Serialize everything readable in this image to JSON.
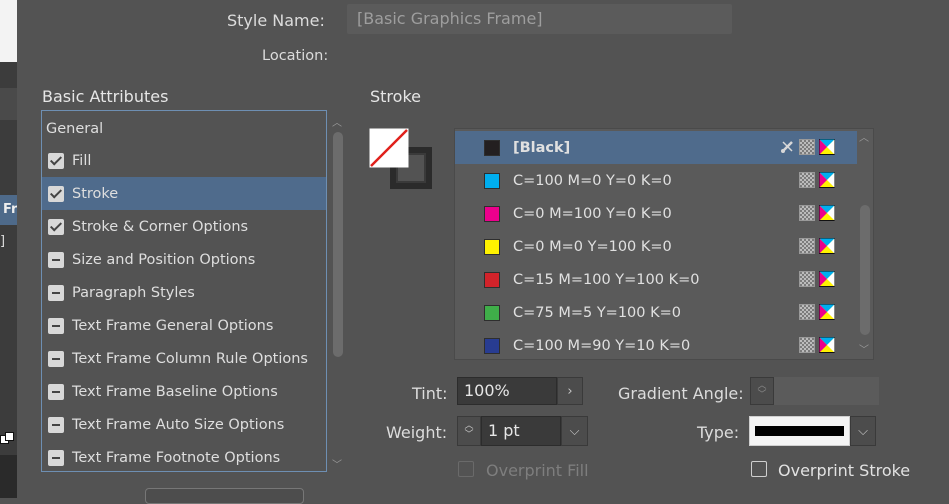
{
  "style_name": {
    "label": "Style Name:",
    "value": "[Basic Graphics Frame]"
  },
  "location": {
    "label": "Location:"
  },
  "basic_attributes": {
    "heading": "Basic Attributes",
    "items": [
      {
        "label": "General",
        "state": "none"
      },
      {
        "label": "Fill",
        "state": "checked"
      },
      {
        "label": "Stroke",
        "state": "checked",
        "selected": true
      },
      {
        "label": "Stroke & Corner Options",
        "state": "checked"
      },
      {
        "label": "Size and Position Options",
        "state": "minus"
      },
      {
        "label": "Paragraph Styles",
        "state": "minus"
      },
      {
        "label": "Text Frame General Options",
        "state": "minus"
      },
      {
        "label": "Text Frame Column Rule Options",
        "state": "minus"
      },
      {
        "label": "Text Frame Baseline Options",
        "state": "minus"
      },
      {
        "label": "Text Frame Auto Size Options",
        "state": "minus"
      },
      {
        "label": "Text Frame Footnote Options",
        "state": "minus"
      }
    ]
  },
  "stroke": {
    "heading": "Stroke",
    "swatches": [
      {
        "label": "[Black]",
        "color": "#231f20",
        "selected": true,
        "icons": [
          "no-edit-icon",
          "process-icon",
          "cmyk-icon"
        ]
      },
      {
        "label": "C=100 M=0 Y=0 K=0",
        "color": "#00aeef",
        "icons": [
          "process-icon",
          "cmyk-icon"
        ]
      },
      {
        "label": "C=0 M=100 Y=0 K=0",
        "color": "#ec008c",
        "icons": [
          "process-icon",
          "cmyk-icon"
        ]
      },
      {
        "label": "C=0 M=0 Y=100 K=0",
        "color": "#fff200",
        "icons": [
          "process-icon",
          "cmyk-icon"
        ]
      },
      {
        "label": "C=15 M=100 Y=100 K=0",
        "color": "#d2232a",
        "icons": [
          "process-icon",
          "cmyk-icon"
        ]
      },
      {
        "label": "C=75 M=5 Y=100 K=0",
        "color": "#3fae49",
        "icons": [
          "process-icon",
          "cmyk-icon"
        ]
      },
      {
        "label": "C=100 M=90 Y=10 K=0",
        "color": "#283c91",
        "icons": [
          "process-icon",
          "cmyk-icon"
        ]
      }
    ],
    "tint": {
      "label": "Tint:",
      "value": "100%"
    },
    "gradient_angle": {
      "label": "Gradient Angle:",
      "value": ""
    },
    "weight": {
      "label": "Weight:",
      "value": "1 pt"
    },
    "type": {
      "label": "Type:"
    },
    "overprint_fill": {
      "label": "Overprint Fill",
      "checked": false,
      "disabled": true
    },
    "overprint_stroke": {
      "label": "Overprint Stroke",
      "checked": false
    }
  },
  "left_panel_fragments": {
    "t1": "Fr",
    "t2": "]"
  }
}
